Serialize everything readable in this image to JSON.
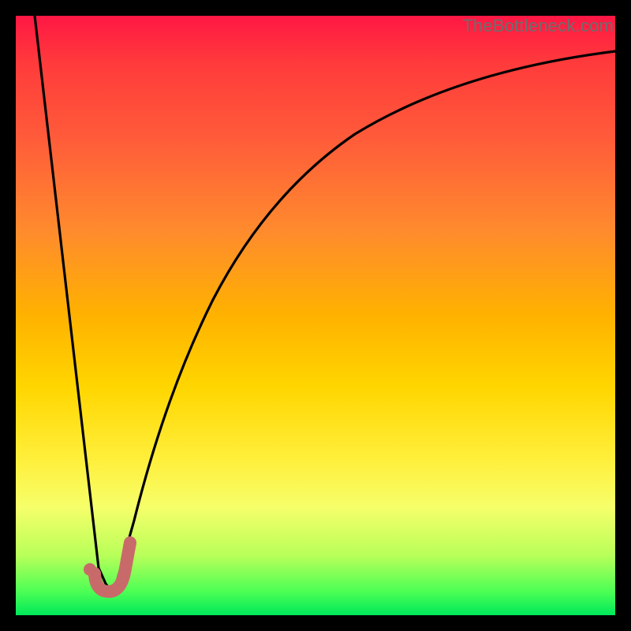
{
  "watermark": "TheBottleneck.com",
  "colors": {
    "curve_stroke": "#000000",
    "marker_stroke": "#c96a6a",
    "marker_fill": "#c96a6a",
    "frame": "#000000"
  },
  "chart_data": {
    "type": "line",
    "title": "",
    "xlabel": "",
    "ylabel": "",
    "xlim": [
      0,
      100
    ],
    "ylim": [
      0,
      100
    ],
    "grid": false,
    "series": [
      {
        "name": "bottleneck-curve",
        "x": [
          3,
          5,
          7,
          9,
          11,
          13,
          14,
          15,
          16,
          18,
          20,
          24,
          30,
          38,
          48,
          60,
          74,
          88,
          100
        ],
        "y": [
          100,
          86,
          72,
          58,
          44,
          22,
          8,
          2,
          2,
          12,
          28,
          48,
          66,
          78,
          86,
          91,
          94,
          95.5,
          96.5
        ],
        "note": "y is percentage height of curve from bottom (higher = worse/red). V-shaped dip near x≈15."
      }
    ],
    "marker": {
      "name": "selected-point",
      "shape": "J-check",
      "x": 15,
      "y": 2,
      "stroke_width_px": 15,
      "color": "#c96a6a"
    }
  }
}
